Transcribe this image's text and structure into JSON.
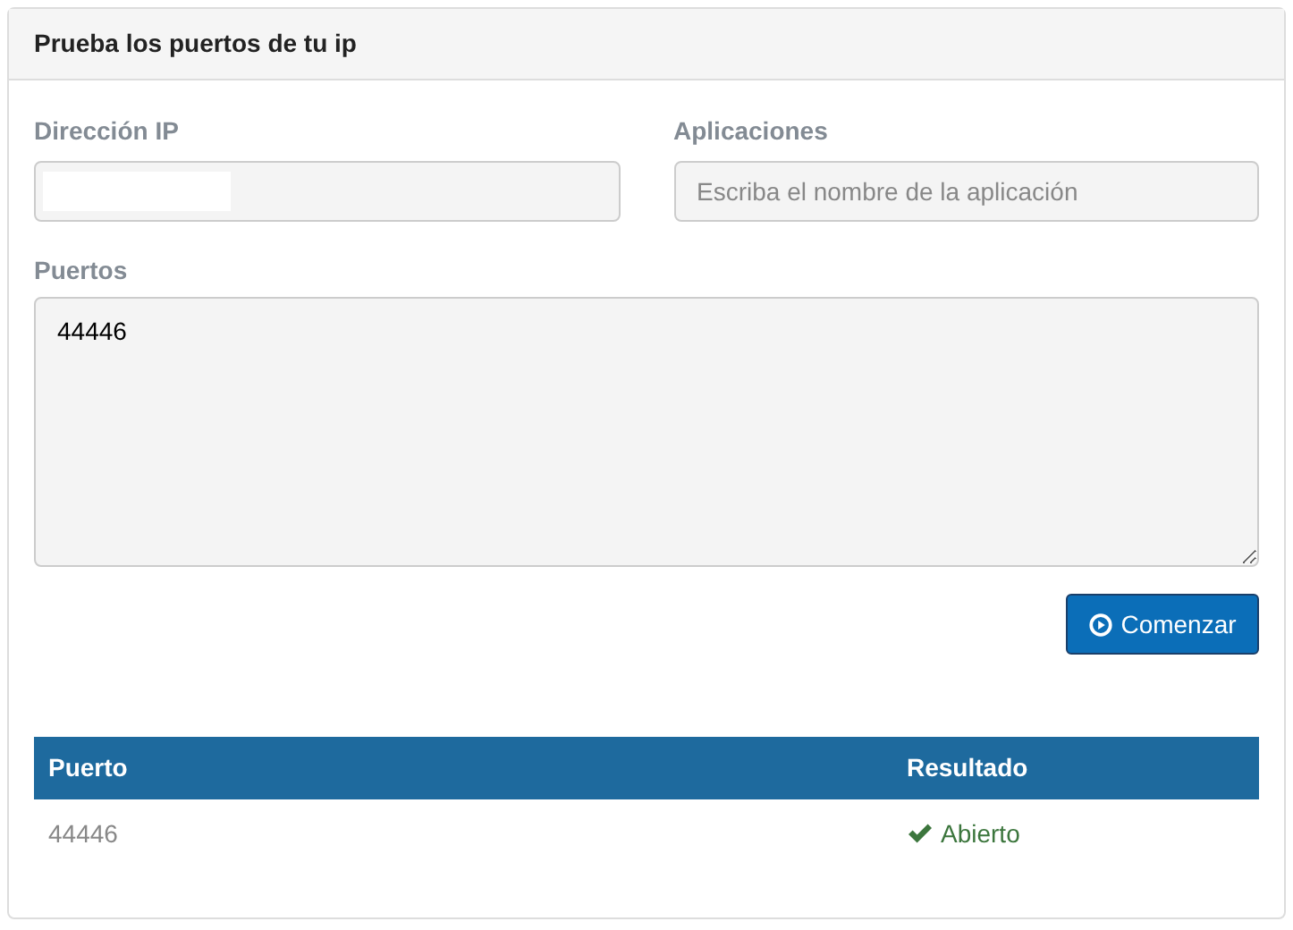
{
  "panel": {
    "title": "Prueba los puertos de tu ip"
  },
  "ip_field": {
    "label": "Dirección IP",
    "redacted": true
  },
  "apps_field": {
    "label": "Aplicaciones",
    "placeholder": "Escriba el nombre de la aplicación"
  },
  "ports_field": {
    "label": "Puertos",
    "value": "44446"
  },
  "start_button": {
    "label": "Comenzar"
  },
  "table": {
    "columns": [
      "Puerto",
      "Resultado"
    ],
    "rows": [
      {
        "port": "44446",
        "result": "Abierto",
        "kind": "open"
      }
    ]
  }
}
